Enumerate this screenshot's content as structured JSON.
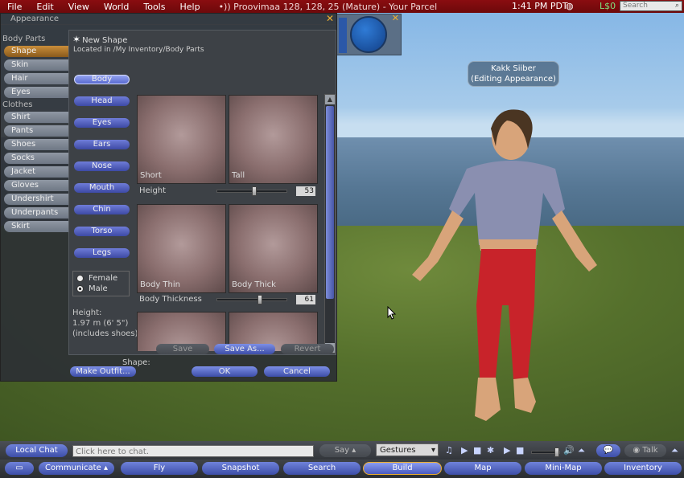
{
  "menubar": {
    "items": [
      "File",
      "Edit",
      "View",
      "World",
      "Tools",
      "Help"
    ],
    "location": "Proovimaa 128, 128, 25 (Mature) - Your Parcel",
    "time": "1:41 PM PDT",
    "balance": "L$0",
    "search_placeholder": "Search"
  },
  "nametag": {
    "name": "Kakk Siiber",
    "status": "(Editing Appearance)"
  },
  "appearance": {
    "title": "Appearance",
    "body_parts_header": "Body Parts",
    "body_parts": [
      "Shape",
      "Skin",
      "Hair",
      "Eyes"
    ],
    "clothes_header": "Clothes",
    "clothes": [
      "Shirt",
      "Pants",
      "Shoes",
      "Socks",
      "Jacket",
      "Gloves",
      "Undershirt",
      "Underpants",
      "Skirt"
    ],
    "new_shape": "New Shape",
    "located_in": "Located in /My Inventory/Body Parts",
    "subparts": [
      "Body",
      "Head",
      "Eyes",
      "Ears",
      "Nose",
      "Mouth",
      "Chin",
      "Torso",
      "Legs"
    ],
    "sex": {
      "female": "Female",
      "male": "Male",
      "selected": "Male"
    },
    "height_info": {
      "label": "Height:",
      "value": "1.97 m (6' 5\")",
      "note": "(includes shoes)"
    },
    "params": [
      {
        "low": "Short",
        "high": "Tall",
        "name": "Height",
        "value": "53",
        "slider": 0.53
      },
      {
        "low": "Body Thin",
        "high": "Body Thick",
        "name": "Body Thickness",
        "value": "61",
        "slider": 0.61
      }
    ],
    "shape_label": "Shape:",
    "save": "Save",
    "save_as": "Save As...",
    "revert": "Revert",
    "make_outfit": "Make Outfit...",
    "ok": "OK",
    "cancel": "Cancel"
  },
  "chatbar": {
    "local_chat": "Local Chat",
    "chat_placeholder": "Click here to chat.",
    "say": "Say",
    "gestures": "Gestures",
    "talk": "Talk"
  },
  "navbar": {
    "buttons": [
      "Communicate",
      "Fly",
      "Snapshot",
      "Search",
      "Build",
      "Map",
      "Mini-Map",
      "Inventory"
    ],
    "active": "Build"
  }
}
